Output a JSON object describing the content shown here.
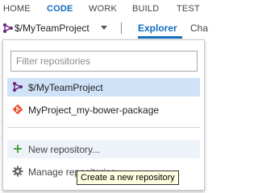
{
  "top_nav": {
    "items": [
      {
        "label": "HOME",
        "active": false
      },
      {
        "label": "CODE",
        "active": true
      },
      {
        "label": "WORK",
        "active": false
      },
      {
        "label": "BUILD",
        "active": false
      },
      {
        "label": "TEST",
        "active": false
      }
    ]
  },
  "project_bar": {
    "project_name": "$/MyTeamProject",
    "tabs": [
      {
        "label": "Explorer",
        "active": true
      },
      {
        "label": "Cha",
        "active": false
      }
    ]
  },
  "repo_dropdown": {
    "filter": {
      "placeholder": "Filter repositories",
      "value": ""
    },
    "repositories": [
      {
        "label": "$/MyTeamProject",
        "icon": "tfvc-icon",
        "selected": true
      },
      {
        "label": "MyProject_my-bower-package",
        "icon": "git-icon",
        "selected": false
      }
    ],
    "actions": [
      {
        "label": "New repository...",
        "icon": "plus-icon"
      },
      {
        "label": "Manage repositories",
        "icon": "gear-icon"
      }
    ],
    "tooltip": "Create a new repository"
  },
  "colors": {
    "accent": "#106ebe",
    "selected_bg": "#cfe2f7",
    "tfvc_purple": "#68217a",
    "git_orange": "#f05033",
    "plus_green": "#339933",
    "tooltip_bg": "#ffffe1"
  }
}
